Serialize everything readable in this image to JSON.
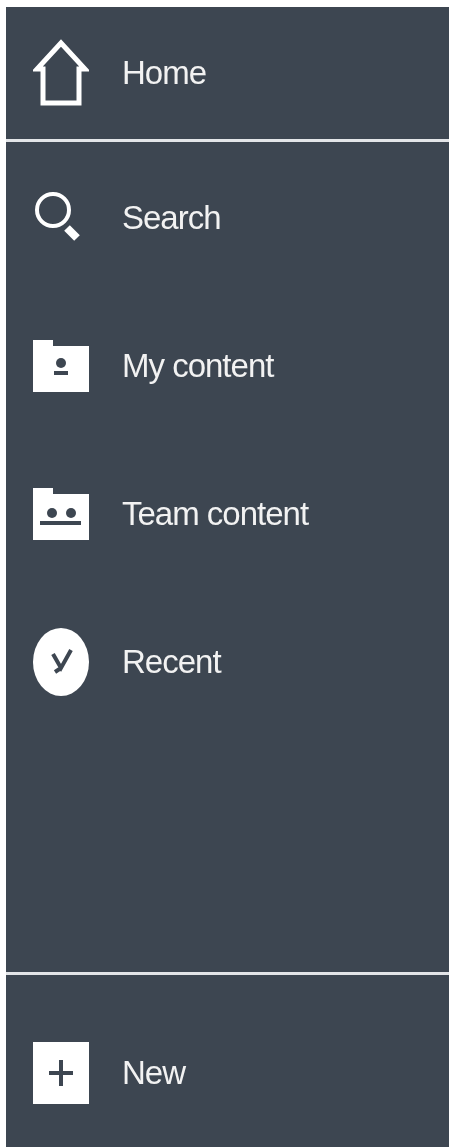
{
  "sections": [
    {
      "items": [
        {
          "kind": "home",
          "label": "Home"
        }
      ]
    },
    {
      "items": [
        {
          "kind": "search",
          "label": "Search"
        },
        {
          "kind": "my-content",
          "label": "My content"
        },
        {
          "kind": "team-content",
          "label": "Team content"
        },
        {
          "kind": "recent",
          "label": "Recent"
        }
      ]
    },
    {
      "items": [
        {
          "kind": "new",
          "label": "New"
        }
      ]
    }
  ]
}
